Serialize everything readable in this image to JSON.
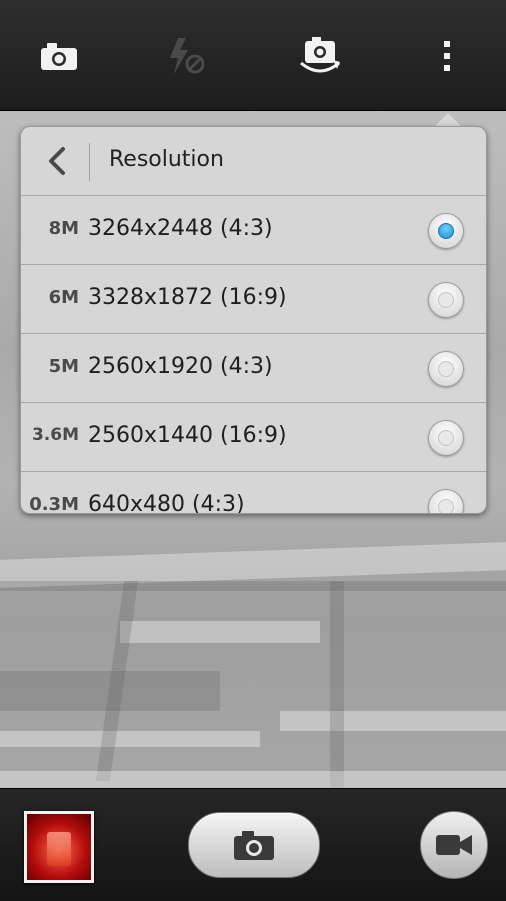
{
  "top_bar": {
    "icons": [
      "camera-mode-icon",
      "flash-off-icon",
      "switch-camera-icon",
      "more-options-icon"
    ]
  },
  "resolution_menu": {
    "title": "Resolution",
    "options": [
      {
        "megapixels": "8M",
        "resolution": "3264x2448 (4:3)",
        "selected": true
      },
      {
        "megapixels": "6M",
        "resolution": "3328x1872 (16:9)",
        "selected": false
      },
      {
        "megapixels": "5M",
        "resolution": "2560x1920 (4:3)",
        "selected": false
      },
      {
        "megapixels": "3.6M",
        "resolution": "2560x1440 (16:9)",
        "selected": false
      },
      {
        "megapixels": "0.3M",
        "resolution": "640x480 (4:3)",
        "selected": false
      }
    ]
  },
  "bottom_bar": {
    "icons": [
      "gallery-thumbnail",
      "shutter-camera-icon",
      "video-camera-icon"
    ]
  },
  "colors": {
    "accent": "#1b8fd0",
    "panel": "#d6d6d6",
    "bar": "#1d1d1d"
  }
}
